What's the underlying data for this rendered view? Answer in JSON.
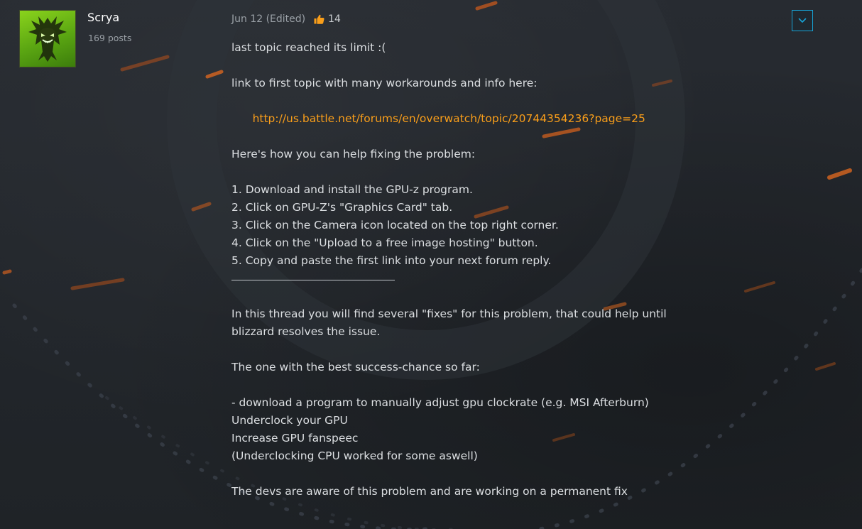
{
  "author": {
    "name": "Scrya",
    "posts": "169 posts",
    "avatar_icon": "green-creature-avatar-icon"
  },
  "meta": {
    "date": "Jun 12 (Edited)",
    "likes": "14",
    "like_icon": "thumbs-up-icon"
  },
  "menu": {
    "icon": "chevron-down-icon"
  },
  "content": {
    "intro": "last topic reached its limit :(",
    "link_prefix": "link to first topic with many workarounds and info here:",
    "link_url": "http://us.battle.net/forums/en/overwatch/topic/20744354236?page=25",
    "help_heading": "Here's how you can help fixing the problem:",
    "steps": [
      "1. Download and install the GPU-z program.",
      "2. Click on GPU-Z's \"Graphics Card\" tab.",
      "3. Click on the Camera icon located on the top right corner.",
      "4. Click on the \"Upload to a free image hosting\" button.",
      "5. Copy and paste the first link into your next forum reply."
    ],
    "thread_line1": "In this thread you will find several \"fixes\" for this problem, that could help until",
    "thread_line2": "blizzard resolves the issue.",
    "best_heading": "The one with the best success-chance so far:",
    "fix_lines": [
      "- download a program to manually adjust gpu clockrate (e.g. MSI Afterburn)",
      "Underclock your GPU",
      "Increase GPU fanspeec",
      "(Underclocking CPU worked for some aswell)"
    ],
    "devs_line": "The devs are aware of this problem and are working on a permanent fix"
  },
  "colors": {
    "link": "#f99e1a",
    "accent": "#17a3d6",
    "like": "#f99e1a"
  }
}
